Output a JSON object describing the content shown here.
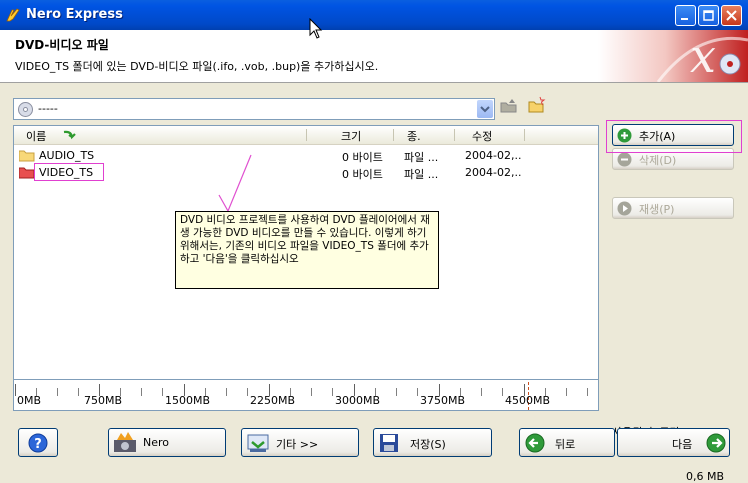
{
  "window": {
    "title": "Nero Express"
  },
  "header": {
    "title": "DVD-비디오 파일",
    "subtitle": "VIDEO_TS 폴더에 있는 DVD-비디오 파일(.ifo, .vob, .bup)을 추가하십시오."
  },
  "location": {
    "value": "-----"
  },
  "columns": {
    "name": "이름",
    "size": "크기",
    "type": "종.",
    "modified": "수정"
  },
  "files": [
    {
      "name": "AUDIO_TS",
      "size": "0 바이트",
      "type": "파일 ...",
      "modified": "2004-02,.."
    },
    {
      "name": "VIDEO_TS",
      "size": "0 바이트",
      "type": "파일 ...",
      "modified": "2004-02,.."
    }
  ],
  "tooltip": {
    "text": "DVD 비디오 프로젝트를 사용하여 DVD 플레이어에서 재생 가능한 DVD 비디오를 만들 수 있습니다. 이렇게 하기 위해서는, 기존의 비디오 파일을 VIDEO_TS 폴더에 추가하고 '다음'을 클릭하십시오"
  },
  "side_buttons": {
    "add": "추가(A)",
    "delete": "삭제(D)",
    "play": "재생(P)"
  },
  "space": {
    "label": "사용된 총 공간:",
    "value": "0,6 MB"
  },
  "size_scale": [
    "0MB",
    "750MB",
    "1500MB",
    "2250MB",
    "3000MB",
    "3750MB",
    "4500MB"
  ],
  "bottom_buttons": {
    "help": "?",
    "nero": "Nero",
    "more": "기타 >>",
    "save": "저장(S)",
    "back": "뒤로",
    "next": "다음"
  }
}
